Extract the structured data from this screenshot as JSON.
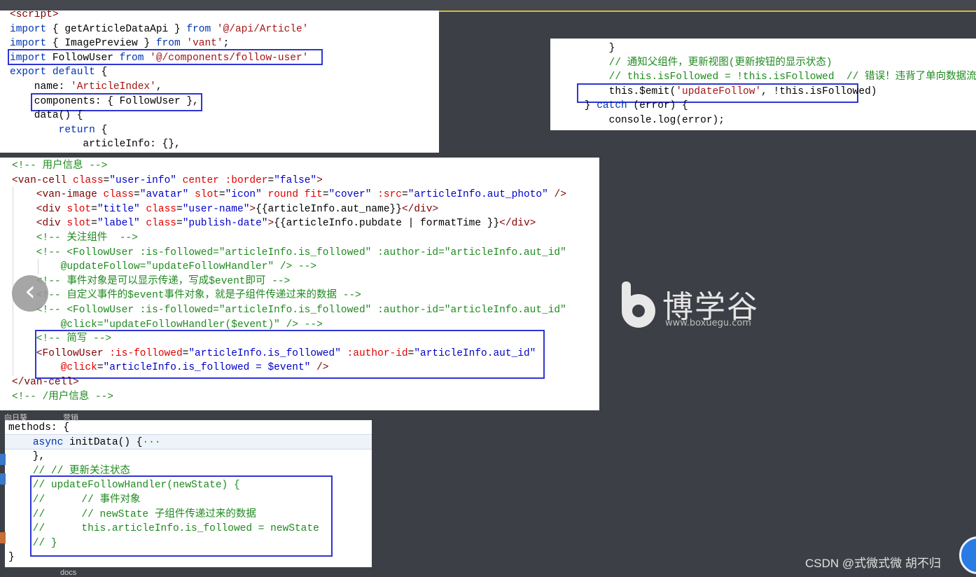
{
  "panel1": {
    "lines": [
      [
        [
          "tag",
          "<script>"
        ]
      ],
      [
        [
          "kw",
          "import"
        ],
        [
          "plain",
          " { getArticleDataApi } "
        ],
        [
          "kw",
          "from"
        ],
        [
          "plain",
          " "
        ],
        [
          "str",
          "'@/api/Article'"
        ]
      ],
      [
        [
          "kw",
          "import"
        ],
        [
          "plain",
          " { ImagePreview } "
        ],
        [
          "kw",
          "from"
        ],
        [
          "plain",
          " "
        ],
        [
          "str",
          "'vant'"
        ],
        [
          "plain",
          ";"
        ]
      ],
      [
        [
          "kw",
          "import"
        ],
        [
          "plain",
          " FollowUser "
        ],
        [
          "kw",
          "from"
        ],
        [
          "plain",
          " "
        ],
        [
          "str",
          "'@/components/follow-user'"
        ]
      ],
      [
        [
          "kw",
          "export default"
        ],
        [
          "plain",
          " {"
        ]
      ],
      [
        [
          "plain",
          "    name: "
        ],
        [
          "str",
          "'ArticleIndex'"
        ],
        [
          "plain",
          ","
        ]
      ],
      [
        [
          "plain",
          "    components: { FollowUser },"
        ]
      ],
      [
        [
          "plain",
          "    data() {"
        ]
      ],
      [
        [
          "plain",
          "        "
        ],
        [
          "kw",
          "return"
        ],
        [
          "plain",
          " {"
        ]
      ],
      [
        [
          "plain",
          "            articleInfo: {},"
        ]
      ]
    ]
  },
  "panel2": {
    "lines": [
      [
        [
          "plain",
          "        }"
        ]
      ],
      [
        [
          "cm",
          "        // 通知父组件，更新视图(更新按钮的显示状态)"
        ]
      ],
      [
        [
          "cm",
          "        // this.isFollowed = !this.isFollowed  // 错误！违背了单向数据流原则"
        ]
      ],
      [
        [
          "plain",
          "        this.$emit("
        ],
        [
          "str",
          "'updateFollow'"
        ],
        [
          "plain",
          ", !this.isFollowed)"
        ]
      ],
      [
        [
          "plain",
          "    } "
        ],
        [
          "kw",
          "catch"
        ],
        [
          "plain",
          " (error) {"
        ]
      ],
      [
        [
          "plain",
          "        console.log(error);"
        ]
      ]
    ]
  },
  "panel3": {
    "lines": [
      [
        [
          "cm",
          "<!-- 用户信息 -->"
        ]
      ],
      [
        [
          "tag",
          "<van-cell"
        ],
        [
          "attr",
          " class"
        ],
        [
          "plain",
          "="
        ],
        [
          "val",
          "\"user-info\""
        ],
        [
          "attr",
          " center"
        ],
        [
          "attr",
          " :border"
        ],
        [
          "plain",
          "="
        ],
        [
          "val",
          "\"false\""
        ],
        [
          "tag",
          ">"
        ]
      ],
      [
        [
          "tag",
          "    <van-image"
        ],
        [
          "attr",
          " class"
        ],
        [
          "plain",
          "="
        ],
        [
          "val",
          "\"avatar\""
        ],
        [
          "attr",
          " slot"
        ],
        [
          "plain",
          "="
        ],
        [
          "val",
          "\"icon\""
        ],
        [
          "attr",
          " round"
        ],
        [
          "attr",
          " fit"
        ],
        [
          "plain",
          "="
        ],
        [
          "val",
          "\"cover\""
        ],
        [
          "attr",
          " :src"
        ],
        [
          "plain",
          "="
        ],
        [
          "val",
          "\"articleInfo.aut_photo\""
        ],
        [
          "tag",
          " />"
        ]
      ],
      [
        [
          "tag",
          "    <div"
        ],
        [
          "attr",
          " slot"
        ],
        [
          "plain",
          "="
        ],
        [
          "val",
          "\"title\""
        ],
        [
          "attr",
          " class"
        ],
        [
          "plain",
          "="
        ],
        [
          "val",
          "\"user-name\""
        ],
        [
          "tag",
          ">"
        ],
        [
          "plain",
          "{{articleInfo.aut_name}}"
        ],
        [
          "tag",
          "</div>"
        ]
      ],
      [
        [
          "tag",
          "    <div"
        ],
        [
          "attr",
          " slot"
        ],
        [
          "plain",
          "="
        ],
        [
          "val",
          "\"label\""
        ],
        [
          "attr",
          " class"
        ],
        [
          "plain",
          "="
        ],
        [
          "val",
          "\"publish-date\""
        ],
        [
          "tag",
          ">"
        ],
        [
          "plain",
          "{{articleInfo.pubdate | formatTime }}"
        ],
        [
          "tag",
          "</div>"
        ]
      ],
      [
        [
          "cm",
          "    <!-- 关注组件  -->"
        ]
      ],
      [
        [
          "cm",
          "    <!-- <FollowUser :is-followed=\"articleInfo.is_followed\" :author-id=\"articleInfo.aut_id\""
        ]
      ],
      [
        [
          "cm",
          "        @updateFollow=\"updateFollowHandler\" /> -->"
        ]
      ],
      [
        [
          "cm",
          "    <!-- 事件对象是可以显示传递，写成$event即可 -->"
        ]
      ],
      [
        [
          "cm",
          "    <!-- 自定义事件的$event事件对象，就是子组件传递过来的数据 -->"
        ]
      ],
      [
        [
          "cm",
          "    <!-- <FollowUser :is-followed=\"articleInfo.is_followed\" :author-id=\"articleInfo.aut_id\""
        ]
      ],
      [
        [
          "cm",
          "        @click=\"updateFollowHandler($event)\" /> -->"
        ]
      ],
      [
        [
          "cm",
          "    <!-- 简写 -->"
        ]
      ],
      [
        [
          "tag",
          "    <FollowUser"
        ],
        [
          "attr",
          " :is-followed"
        ],
        [
          "plain",
          "="
        ],
        [
          "val",
          "\"articleInfo.is_followed\""
        ],
        [
          "attr",
          " :author-id"
        ],
        [
          "plain",
          "="
        ],
        [
          "val",
          "\"articleInfo.aut_id\""
        ]
      ],
      [
        [
          "attr",
          "        @click"
        ],
        [
          "plain",
          "="
        ],
        [
          "val",
          "\"articleInfo.is_followed = $event\""
        ],
        [
          "tag",
          " />"
        ]
      ],
      [
        [
          "tag",
          "</van-cell>"
        ]
      ],
      [
        [
          "cm",
          "<!-- /用户信息 -->"
        ]
      ]
    ]
  },
  "panel4": {
    "lines": [
      [
        [
          "plain",
          "methods: {"
        ]
      ],
      [
        [
          "plain",
          "    "
        ],
        [
          "kw",
          "async"
        ],
        [
          "plain",
          " initData() {"
        ],
        [
          "cm",
          "···"
        ]
      ],
      [
        [
          "plain",
          "    },"
        ]
      ],
      [
        [
          "cm",
          "    // // 更新关注状态"
        ]
      ],
      [
        [
          "cm",
          "    // updateFollowHandler(newState) {"
        ]
      ],
      [
        [
          "cm",
          "    //      // 事件对象"
        ]
      ],
      [
        [
          "cm",
          "    //      // newState 子组件传递过来的数据"
        ]
      ],
      [
        [
          "cm",
          "    //      this.articleInfo.is_followed = newState"
        ]
      ],
      [
        [
          "cm",
          "    // }"
        ]
      ],
      [
        [
          "plain",
          "}"
        ]
      ]
    ]
  },
  "logo": {
    "name": "博学谷",
    "url": "www.boxuegu.com"
  },
  "nav": {
    "prev_symbol": "‹"
  },
  "watermark": "CSDN @式微式微   胡不归",
  "desktop": {
    "label1": "向日葵",
    "label2": "营销",
    "label3": "docs"
  },
  "colors": {
    "highlight": "#2f35d4",
    "background": "#3c3f45"
  }
}
